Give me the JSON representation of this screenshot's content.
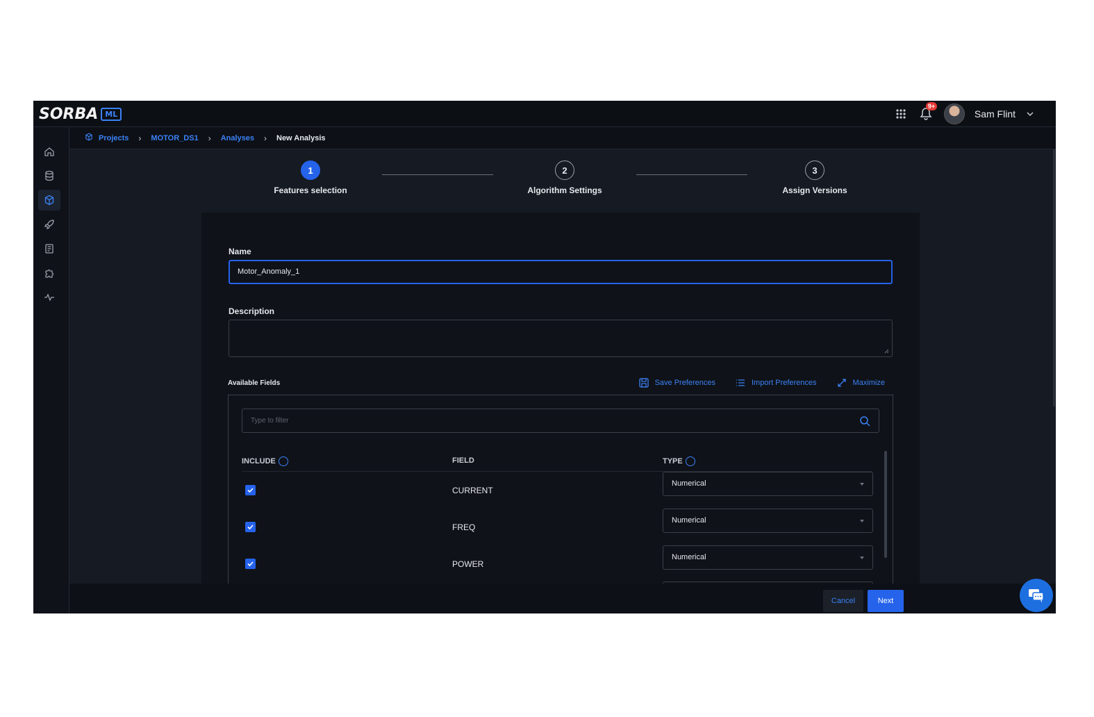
{
  "app": {
    "logo_text": "SORBA",
    "logo_badge": "ML",
    "notification_count": "9+",
    "user_name": "Sam Flint"
  },
  "sidebar": {
    "items": [
      {
        "icon": "home-icon"
      },
      {
        "icon": "database-icon"
      },
      {
        "icon": "cube-icon",
        "active": true
      },
      {
        "icon": "rocket-icon"
      },
      {
        "icon": "document-icon"
      },
      {
        "icon": "puzzle-icon"
      },
      {
        "icon": "activity-icon"
      }
    ]
  },
  "breadcrumb": {
    "items": [
      "Projects",
      "MOTOR_DS1",
      "Analyses"
    ],
    "current": "New Analysis"
  },
  "stepper": {
    "steps": [
      {
        "number": "1",
        "label": "Features selection",
        "active": true
      },
      {
        "number": "2",
        "label": "Algorithm Settings",
        "active": false
      },
      {
        "number": "3",
        "label": "Assign Versions",
        "active": false
      }
    ]
  },
  "form": {
    "name_label": "Name",
    "name_value": "Motor_Anomaly_1",
    "description_label": "Description",
    "description_value": "",
    "available_fields_label": "Available Fields",
    "save_preferences": "Save Preferences",
    "import_preferences": "Import Preferences",
    "maximize": "Maximize",
    "filter_placeholder": "Type to filter",
    "columns": {
      "include": "INCLUDE",
      "field": "FIELD",
      "type": "TYPE"
    },
    "rows": [
      {
        "included": true,
        "field": "CURRENT",
        "type": "Numerical"
      },
      {
        "included": true,
        "field": "FREQ",
        "type": "Numerical"
      },
      {
        "included": true,
        "field": "POWER",
        "type": "Numerical"
      }
    ]
  },
  "footer": {
    "cancel_label": "Cancel",
    "next_label": "Next"
  },
  "colors": {
    "accent": "#2563eb",
    "link": "#3b82f6",
    "background": "#11151c",
    "badge": "#e53935"
  }
}
